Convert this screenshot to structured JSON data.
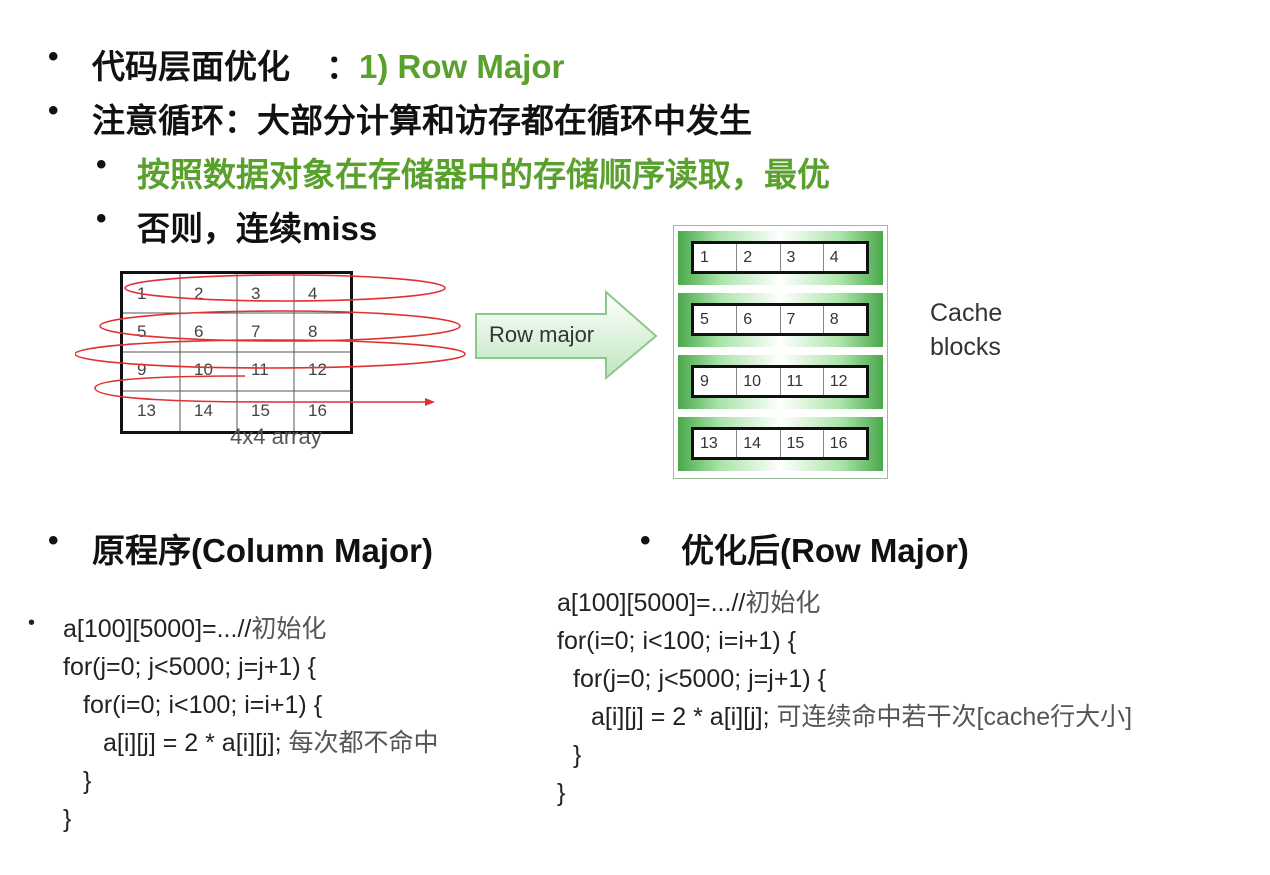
{
  "bullets": {
    "b1": {
      "text": "代码层面优化",
      "colon": "：",
      "highlight": "1) Row Major"
    },
    "b2": {
      "text": "注意循环：大部分计算和访存都在循环中发生"
    },
    "b3": {
      "text": "按照数据对象在存储器中的存储顺序读取，最优"
    },
    "b4": {
      "text": "否则，连续miss"
    },
    "bullet_char": "•"
  },
  "array_figure": {
    "cells": [
      "1",
      "2",
      "3",
      "4",
      "5",
      "6",
      "7",
      "8",
      "9",
      "10",
      "11",
      "12",
      "13",
      "14",
      "15",
      "16"
    ],
    "caption": "4x4 array"
  },
  "arrow": {
    "label": "Row major"
  },
  "cache": {
    "rows": [
      [
        "1",
        "2",
        "3",
        "4"
      ],
      [
        "5",
        "6",
        "7",
        "8"
      ],
      [
        "9",
        "10",
        "11",
        "12"
      ],
      [
        "13",
        "14",
        "15",
        "16"
      ]
    ],
    "label_line1": "Cache",
    "label_line2": "blocks"
  },
  "left_section": {
    "heading": "原程序(Column Major)",
    "code_bullet": "•",
    "code": [
      {
        "text": "a[100][5000]=...//",
        "comment": "初始化"
      },
      {
        "text": "for(j=0; j<5000; j=j+1) {",
        "comment": ""
      },
      {
        "text": "for(i=0; i<100; i=i+1) {",
        "comment": ""
      },
      {
        "text": "a[i][j] = 2 * a[i][j]; ",
        "comment": "每次都不命中"
      },
      {
        "text": "}",
        "comment": ""
      },
      {
        "text": "}",
        "comment": ""
      }
    ]
  },
  "right_section": {
    "heading": "优化后(Row Major)",
    "code": [
      {
        "text": "a[100][5000]=...//",
        "comment": "初始化"
      },
      {
        "text": "for(i=0; i<100; i=i+1) {",
        "comment": ""
      },
      {
        "text": "for(j=0; j<5000; j=j+1) {",
        "comment": ""
      },
      {
        "text": "a[i][j] = 2 * a[i][j]; ",
        "comment": "可连续命中若干次[cache行大小]"
      },
      {
        "text": "}",
        "comment": ""
      },
      {
        "text": "}",
        "comment": ""
      }
    ]
  },
  "colors": {
    "accent_green": "#5aa02c",
    "trace_red": "#e03030"
  }
}
